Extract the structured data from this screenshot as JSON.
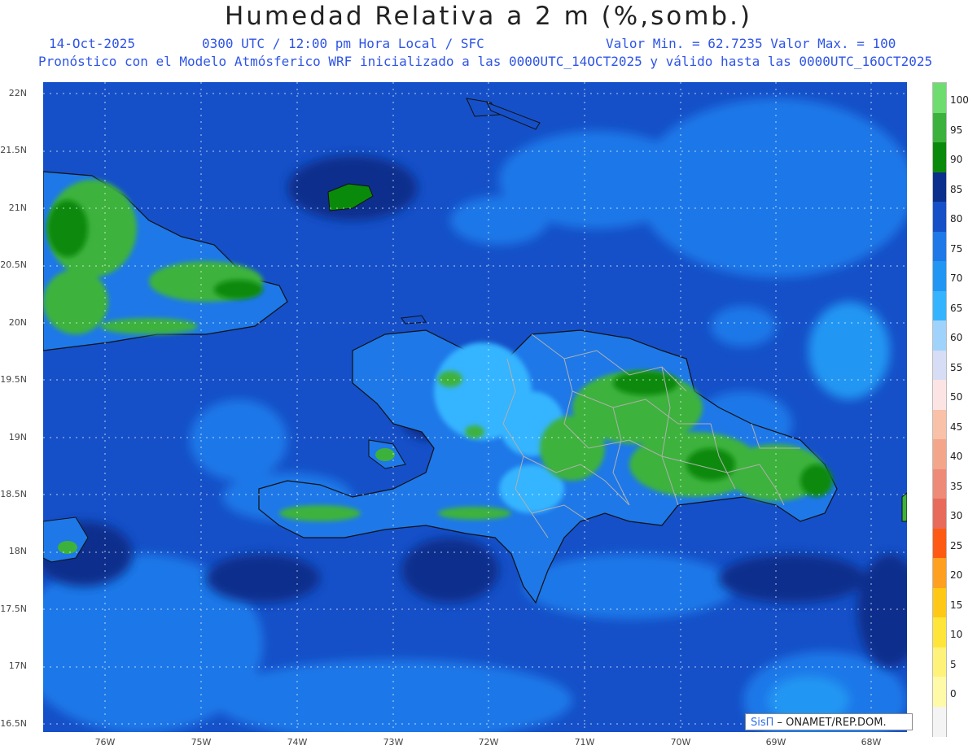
{
  "header": {
    "title": "Humedad Relativa a 2 m (%,somb.)",
    "date": "14-Oct-2025",
    "time": "0300 UTC / 12:00 pm Hora Local / SFC",
    "minmax": "Valor Min. = 62.7235  Valor Max. = 100",
    "subtitle": "Pronóstico con el Modelo Atmósferico WRF inicializado a las 0000UTC_14OCT2025 y válido hasta las  0000UTC_16OCT2025"
  },
  "axes": {
    "lat_labels": [
      "22N",
      "21.5N",
      "21N",
      "20.5N",
      "20N",
      "19.5N",
      "19N",
      "18.5N",
      "18N",
      "17.5N",
      "17N",
      "16.5N"
    ],
    "lon_labels": [
      "76W",
      "75W",
      "74W",
      "73W",
      "72W",
      "71W",
      "70W",
      "69W",
      "68W"
    ]
  },
  "legend": {
    "labels": [
      "100",
      "95",
      "90",
      "85",
      "80",
      "75",
      "70",
      "65",
      "60",
      "55",
      "50",
      "45",
      "40",
      "35",
      "30",
      "25",
      "20",
      "15",
      "10",
      "5",
      "0"
    ],
    "colors": [
      "#6fdc6f",
      "#3cb23c",
      "#0a8a0a",
      "#0a2f8c",
      "#1550c8",
      "#1e78e8",
      "#2196f3",
      "#34b4ff",
      "#9fd3fb",
      "#d6ddf5",
      "#fde4e4",
      "#f8c1a8",
      "#f3a68a",
      "#ee8a78",
      "#e86a5a",
      "#ff5a14",
      "#ffa020",
      "#ffc816",
      "#ffe53a",
      "#fff27a",
      "#fffaa8",
      "#f4f4f4"
    ]
  },
  "credit": {
    "brand": "SisΠ",
    "text": " – ONAMET/REP.DOM."
  }
}
